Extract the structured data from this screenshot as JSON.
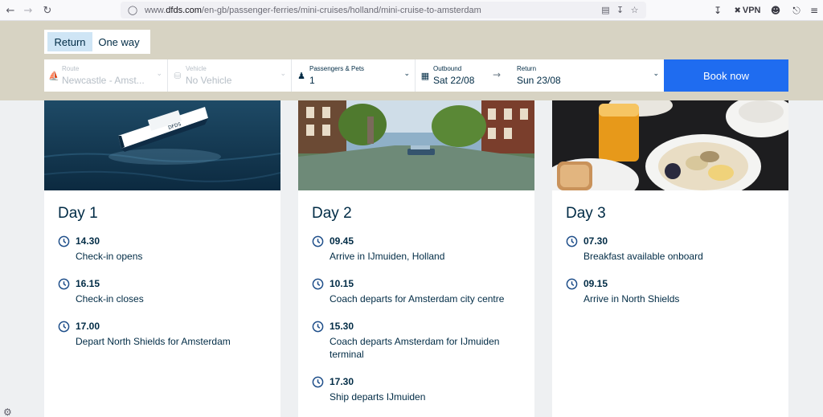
{
  "browser": {
    "url_prefix": "www.",
    "url_domain": "dfds.com",
    "url_path": "/en-gb/passenger-ferries/mini-cruises/holland/mini-cruise-to-amsterdam",
    "vpn_label": "VPN"
  },
  "booking": {
    "trip_types": [
      "Return",
      "One way"
    ],
    "route": {
      "label": "Route",
      "value": "Newcastle - Amst..."
    },
    "vehicle": {
      "label": "Vehicle",
      "value": "No Vehicle"
    },
    "passengers": {
      "label": "Passengers & Pets",
      "value": "1"
    },
    "outbound": {
      "label": "Outbound",
      "value": "Sat 22/08"
    },
    "return": {
      "label": "Return",
      "value": "Sun 23/08"
    },
    "book_label": "Book now"
  },
  "itinerary": [
    {
      "day": "Day 1",
      "events": [
        {
          "time": "14.30",
          "desc": "Check-in opens"
        },
        {
          "time": "16.15",
          "desc": "Check-in closes"
        },
        {
          "time": "17.00",
          "desc": "Depart North Shields for Amsterdam"
        }
      ]
    },
    {
      "day": "Day 2",
      "events": [
        {
          "time": "09.45",
          "desc": "Arrive in IJmuiden, Holland"
        },
        {
          "time": "10.15",
          "desc": "Coach departs for Amsterdam city centre"
        },
        {
          "time": "15.30",
          "desc": "Coach departs Amsterdam for IJmuiden terminal"
        },
        {
          "time": "17.30",
          "desc": "Ship departs IJmuiden"
        }
      ]
    },
    {
      "day": "Day 3",
      "events": [
        {
          "time": "07.30",
          "desc": "Breakfast available onboard"
        },
        {
          "time": "09.15",
          "desc": "Arrive in North Shields"
        }
      ]
    }
  ],
  "colors": {
    "accent": "#1f6cf0",
    "navy": "#002b45",
    "band": "#d7d3c3"
  }
}
